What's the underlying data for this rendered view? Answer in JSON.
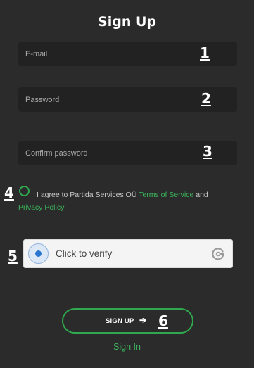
{
  "title": "Sign Up",
  "fields": {
    "email": {
      "placeholder": "E-mail",
      "value": "",
      "marker": "1"
    },
    "password": {
      "placeholder": "Password",
      "value": "",
      "marker": "2"
    },
    "confirm": {
      "placeholder": "Confirm password",
      "value": "",
      "marker": "3"
    }
  },
  "agreement": {
    "marker": "4",
    "text_before": "I agree to Partida Services OÜ ",
    "terms_link": "Terms of Service",
    "text_middle": " and ",
    "privacy_link": "Privacy Policy",
    "checked": false
  },
  "captcha": {
    "marker": "5",
    "label": "Click to verify",
    "logo_icon": "captcha-logo-icon"
  },
  "signup_button": {
    "marker": "6",
    "label": "SIGN UP",
    "arrow": "➔"
  },
  "signin_link": "Sign In",
  "colors": {
    "background": "#2b2b2b",
    "field_background": "#222222",
    "accent_green": "#2fa84f",
    "captcha_blue": "#2a75d0"
  }
}
